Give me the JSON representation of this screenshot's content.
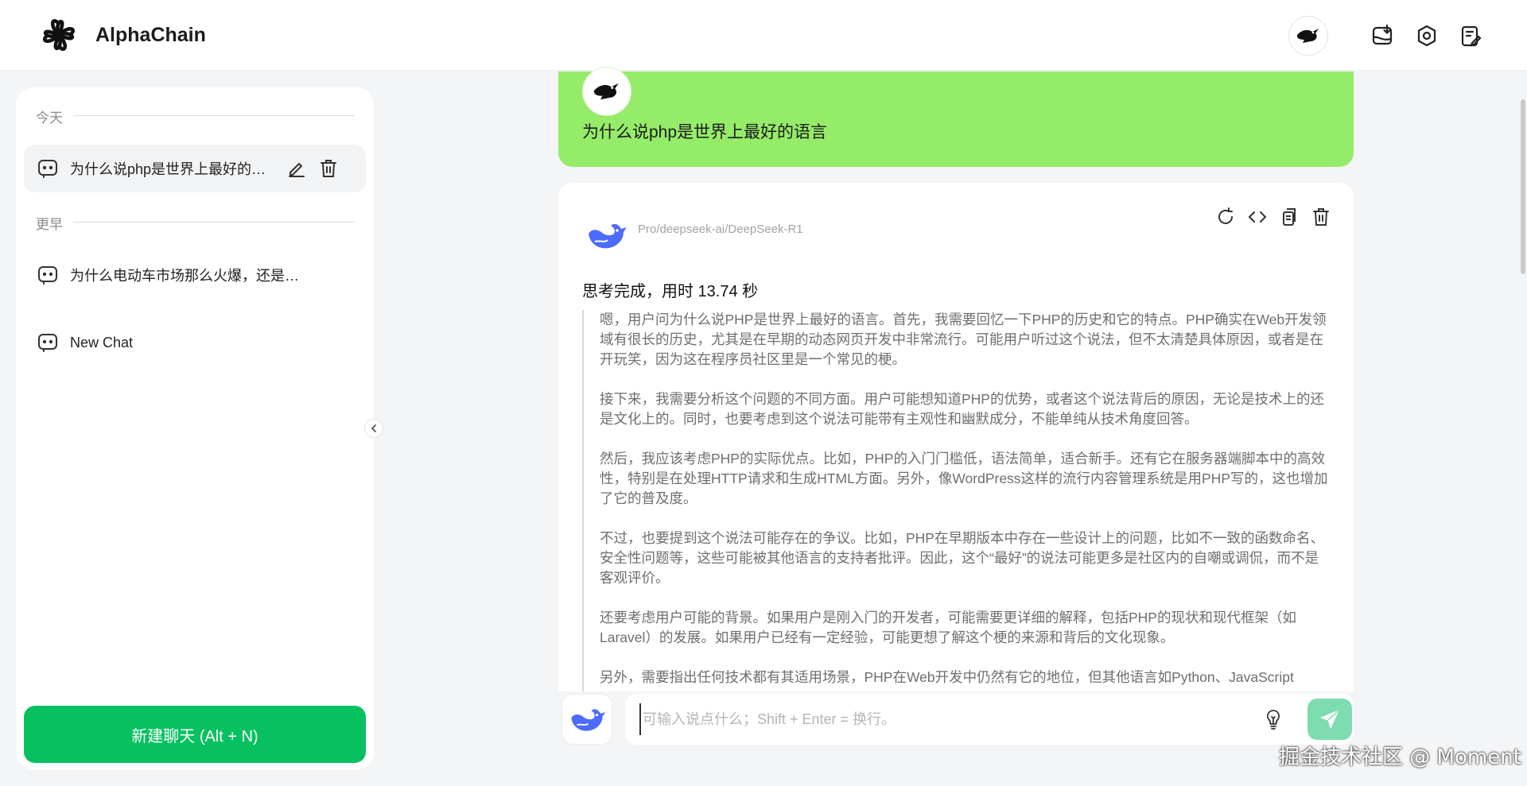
{
  "app": {
    "title": "AlphaChain"
  },
  "header": {
    "icons": [
      "avatar",
      "download-icon",
      "settings-icon",
      "notes-icon"
    ]
  },
  "sidebar": {
    "section_today": "今天",
    "section_earlier": "更早",
    "items": [
      {
        "label": "为什么说php是世界上最好的语言",
        "active": true
      },
      {
        "label": "为什么电动车市场那么火爆，还是有人要买燃油车？"
      },
      {
        "label": "New Chat"
      }
    ],
    "new_chat_label": "新建聊天 (Alt + N)",
    "accent": "#07c160"
  },
  "conversation": {
    "user_message": "为什么说php是世界上最好的语言",
    "user_bubble_color": "#95ec69",
    "model_name": "Pro/deepseek-ai/DeepSeek-R1",
    "think_title": "思考完成，用时 13.74 秒",
    "think_paragraphs": [
      "嗯，用户问为什么说PHP是世界上最好的语言。首先，我需要回忆一下PHP的历史和它的特点。PHP确实在Web开发领域有很长的历史，尤其是在早期的动态网页开发中非常流行。可能用户听过这个说法，但不太清楚具体原因，或者是在开玩笑，因为这在程序员社区里是一个常见的梗。",
      "接下来，我需要分析这个问题的不同方面。用户可能想知道PHP的优势，或者这个说法背后的原因，无论是技术上的还是文化上的。同时，也要考虑到这个说法可能带有主观性和幽默成分，不能单纯从技术角度回答。",
      "然后，我应该考虑PHP的实际优点。比如，PHP的入门门槛低，语法简单，适合新手。还有它在服务器端脚本中的高效性，特别是在处理HTTP请求和生成HTML方面。另外，像WordPress这样的流行内容管理系统是用PHP写的，这也增加了它的普及度。",
      "不过，也要提到这个说法可能存在的争议。比如，PHP在早期版本中存在一些设计上的问题，比如不一致的函数命名、安全性问题等，这些可能被其他语言的支持者批评。因此，这个“最好”的说法可能更多是社区内的自嘲或调侃，而不是客观评价。",
      "还要考虑用户可能的背景。如果用户是刚入门的开发者，可能需要更详细的解释，包括PHP的现状和现代框架（如Laravel）的发展。如果用户已经有一定经验，可能更想了解这个梗的来源和背后的文化现象。",
      "另外，需要指出任何技术都有其适用场景，PHP在Web开发中仍然有它的地位，但其他语言如Python、JavaScript"
    ]
  },
  "input": {
    "placeholder": "可输入说点什么；Shift + Enter = 换行。",
    "value": ""
  },
  "watermark": "掘金技术社区 @ Moment"
}
